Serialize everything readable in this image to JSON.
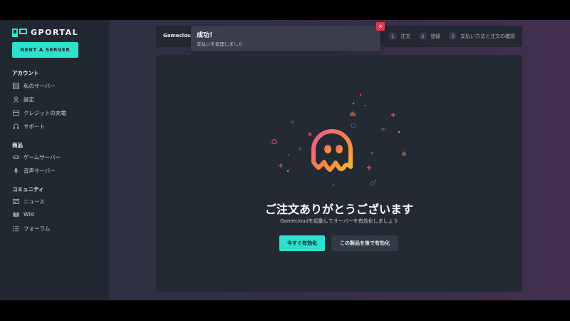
{
  "brand": {
    "name": "GPORTAL",
    "accent": "#2de1cc"
  },
  "sidebar": {
    "rent_button": "RENT A SERVER",
    "sections": [
      {
        "title": "アカウント",
        "items": [
          {
            "label": "私のサーバー",
            "icon": "server-icon"
          },
          {
            "label": "設定",
            "icon": "user-icon"
          },
          {
            "label": "クレジットの充電",
            "icon": "credit-card-icon"
          },
          {
            "label": "サポート",
            "icon": "headset-icon"
          }
        ]
      },
      {
        "title": "商品",
        "items": [
          {
            "label": "ゲームサーバー",
            "icon": "gamepad-icon"
          },
          {
            "label": "音声サーバー",
            "icon": "microphone-icon"
          }
        ]
      },
      {
        "title": "コミュニティ",
        "items": [
          {
            "label": "ニュース",
            "icon": "newspaper-icon"
          },
          {
            "label": "Wiki",
            "icon": "book-icon"
          },
          {
            "label": "フォーラム",
            "icon": "list-icon"
          }
        ]
      }
    ]
  },
  "topbar": {
    "product": "Gamecloud",
    "steps": [
      {
        "num": "1",
        "label": "注文"
      },
      {
        "num": "2",
        "label": "登録"
      },
      {
        "num": "3",
        "label": "支払い方法と注文の確認"
      }
    ]
  },
  "toast": {
    "title": "成功！",
    "message": "支払いを処理しました",
    "close": "×"
  },
  "main": {
    "heading": "ご注文ありがとうございます",
    "subtext": "Gamecloudを起動してサーバーを有効化しましょう",
    "primary_button": "今すぐ有効化",
    "secondary_button": "この製品を後で有効化"
  }
}
